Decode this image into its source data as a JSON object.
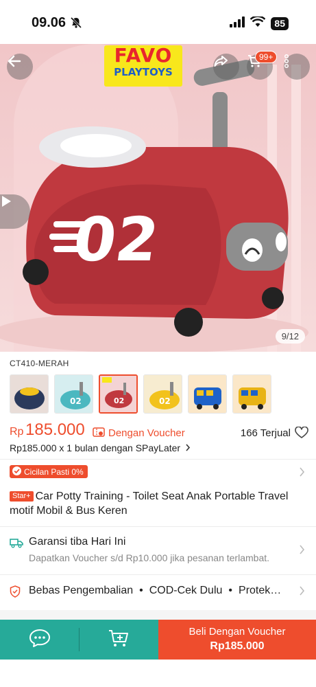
{
  "status_bar": {
    "time": "09.06",
    "battery": "85"
  },
  "hero": {
    "image_counter": "9/12",
    "cart_badge": "99+",
    "logo_line1": "FAVO",
    "logo_line2": "PLAYTOYS",
    "product_number": "02"
  },
  "variant": {
    "name": "CT410-MERAH",
    "thumbnails": [
      {
        "color": "#2b3a5c",
        "label": ""
      },
      {
        "color": "#4bb8c0",
        "label": "02"
      },
      {
        "color": "#c0393f",
        "label": "02"
      },
      {
        "color": "#f2c21c",
        "label": "02"
      },
      {
        "color": "#1e62c8",
        "label": ""
      },
      {
        "color": "#e8b316",
        "label": ""
      }
    ],
    "selected_index": 2
  },
  "price": {
    "currency": "Rp",
    "value": "185.000",
    "voucher_text": "Dengan Voucher",
    "sold": "166 Terjual",
    "paylater": "Rp185.000 x 1 bulan dengan SPayLater"
  },
  "cicilan_badge": "Cicilan Pasti 0%",
  "title": {
    "badge": "Star+",
    "text": "Car Potty Training - Toilet Seat Anak Portable Travel motif Mobil & Bus Keren"
  },
  "shipping": {
    "title": "Garansi tiba Hari Ini",
    "subtitle": "Dapatkan Voucher s/d Rp10.000 jika pesanan terlambat."
  },
  "services": {
    "item1": "Bebas Pengembalian",
    "item2": "COD-Cek Dulu",
    "item3": "Protek…"
  },
  "bottom_bar": {
    "buy_label": "Beli Dengan Voucher",
    "buy_price": "Rp185.000"
  },
  "colors": {
    "accent": "#ee4d2d",
    "teal": "#26aa99",
    "potty_red": "#c0393f"
  }
}
